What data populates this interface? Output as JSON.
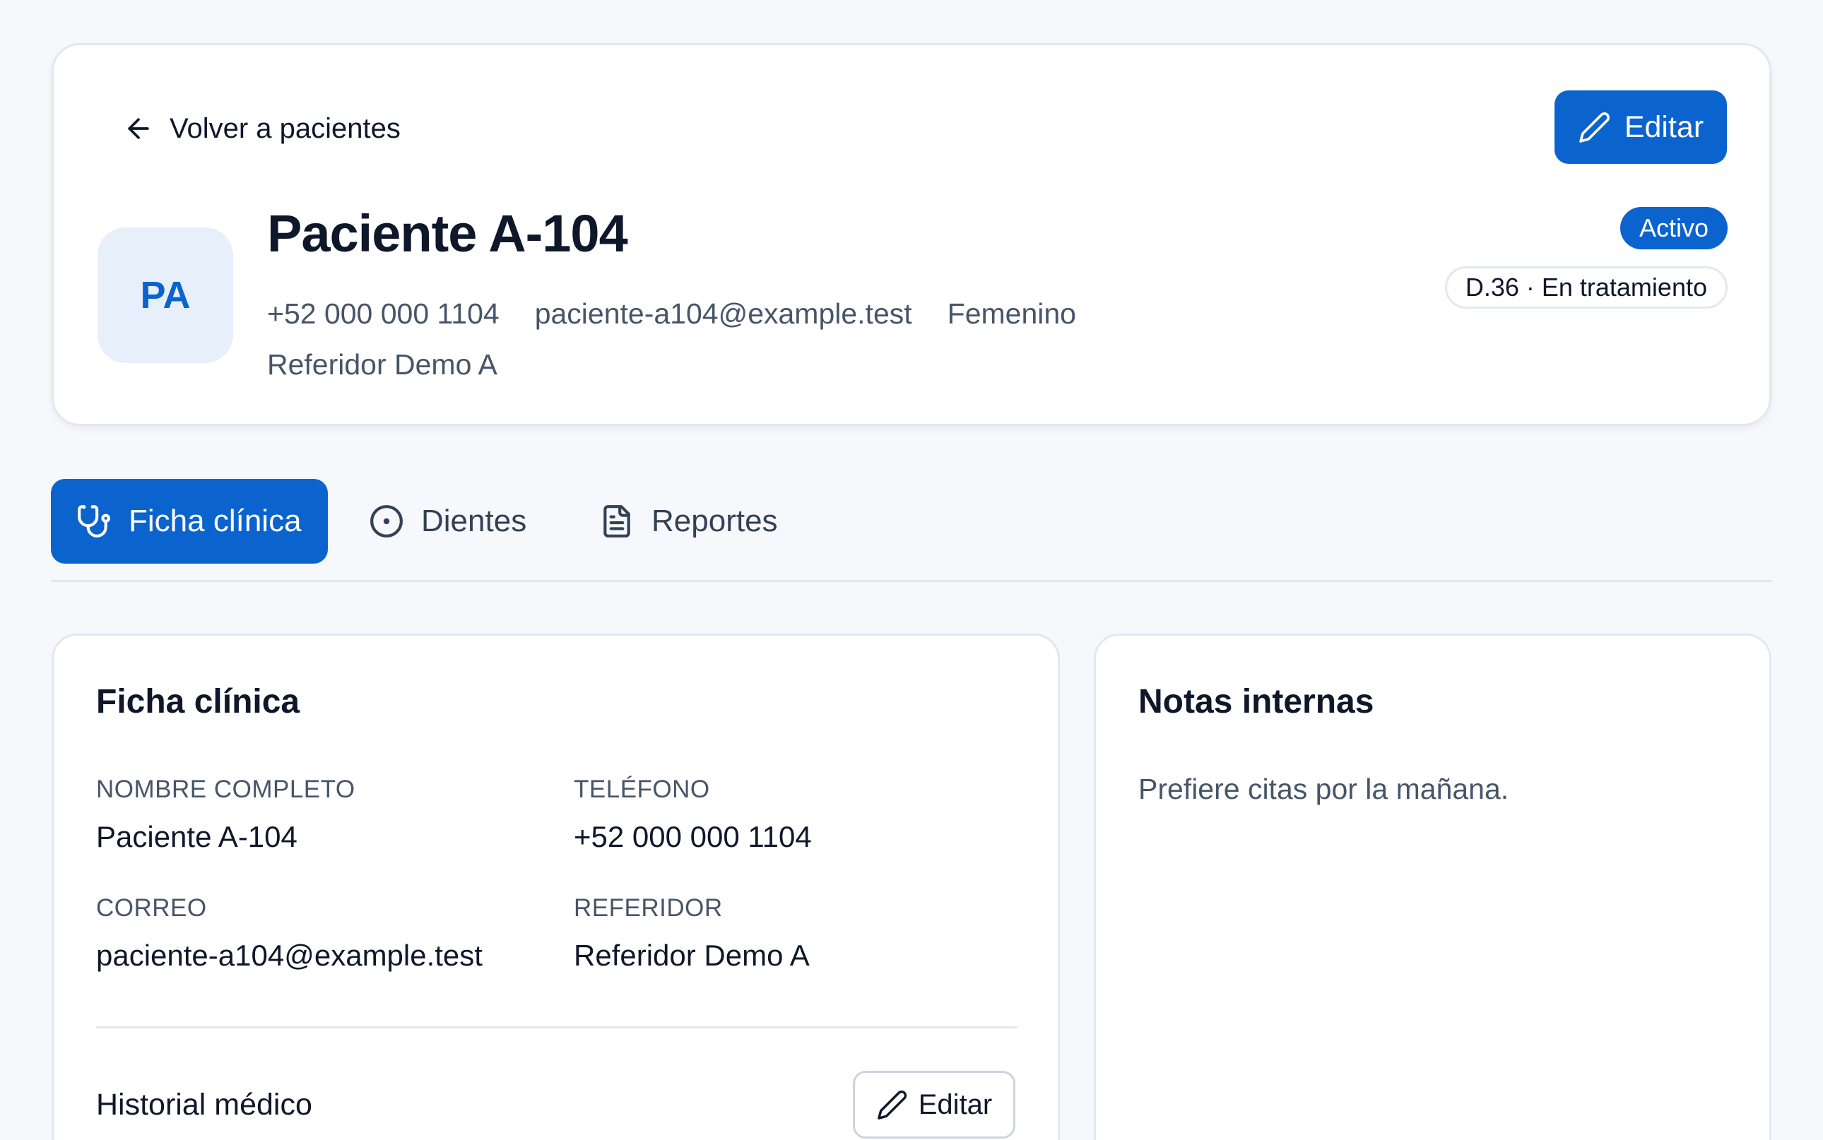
{
  "header": {
    "back_label": "Volver a pacientes",
    "edit_label": "Editar",
    "avatar_initials": "PA",
    "patient_name": "Paciente A-104",
    "phone": "+52 000 000 1104",
    "email": "paciente-a104@example.test",
    "gender": "Femenino",
    "referrer": "Referidor Demo A",
    "status": "Activo",
    "treatment": "D.36 · En tratamiento"
  },
  "tabs": [
    {
      "label": "Ficha clínica",
      "icon": "stethoscope-icon",
      "active": true
    },
    {
      "label": "Dientes",
      "icon": "circle-dot-icon",
      "active": false
    },
    {
      "label": "Reportes",
      "icon": "file-text-icon",
      "active": false
    }
  ],
  "ficha": {
    "title": "Ficha clínica",
    "fields": {
      "name_label": "NOMBRE COMPLETO",
      "name_value": "Paciente A-104",
      "phone_label": "TELÉFONO",
      "phone_value": "+52 000 000 1104",
      "email_label": "CORREO",
      "email_value": "paciente-a104@example.test",
      "referrer_label": "REFERIDOR",
      "referrer_value": "Referidor Demo A"
    },
    "history_title": "Historial médico",
    "history_edit_label": "Editar"
  },
  "notes": {
    "title": "Notas internas",
    "text": "Prefiere citas por la mañana."
  },
  "colors": {
    "accent": "#0b63ce",
    "background": "#f6f8fb",
    "border": "#e2e8f0",
    "muted_text": "#475569"
  }
}
